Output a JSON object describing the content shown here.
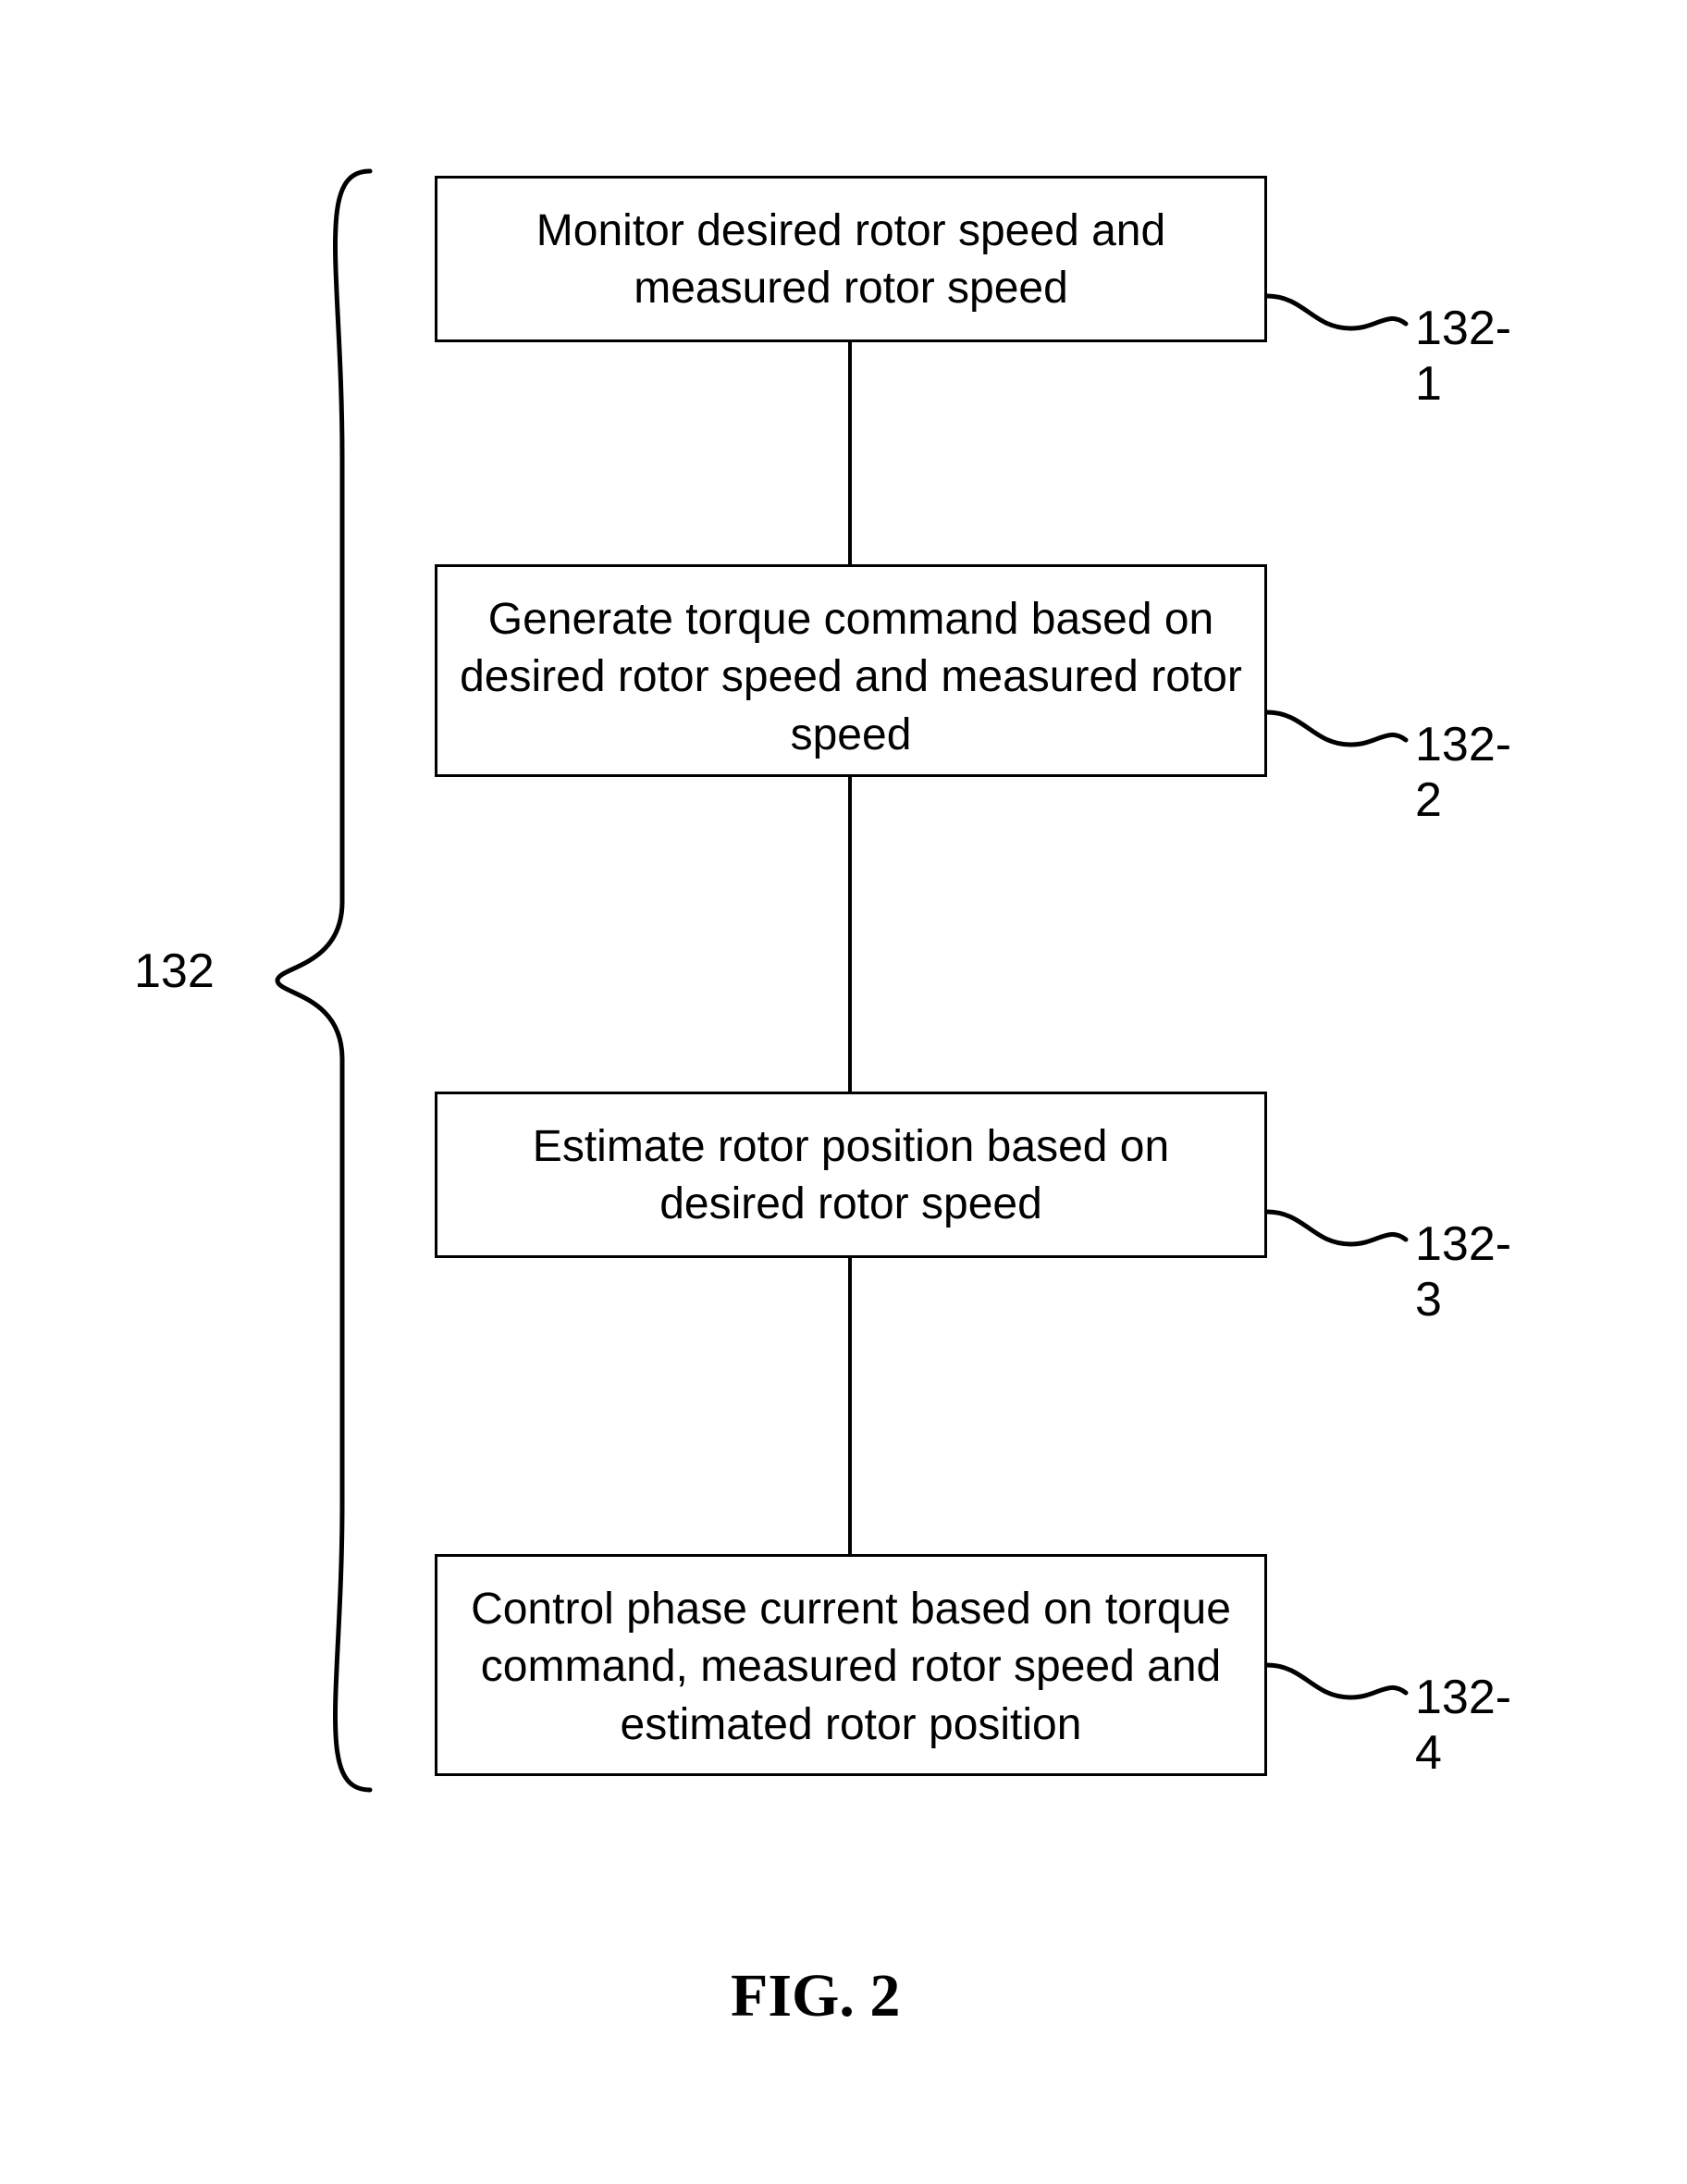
{
  "caption": "FIG. 2",
  "group_label": "132",
  "steps": [
    {
      "id": "132-1",
      "text": "Monitor desired rotor speed and measured rotor speed"
    },
    {
      "id": "132-2",
      "text": "Generate torque command based on desired rotor speed and measured rotor speed"
    },
    {
      "id": "132-3",
      "text": "Estimate rotor position based on desired rotor speed"
    },
    {
      "id": "132-4",
      "text": "Control phase current based on torque command, measured rotor speed and estimated rotor position"
    }
  ]
}
